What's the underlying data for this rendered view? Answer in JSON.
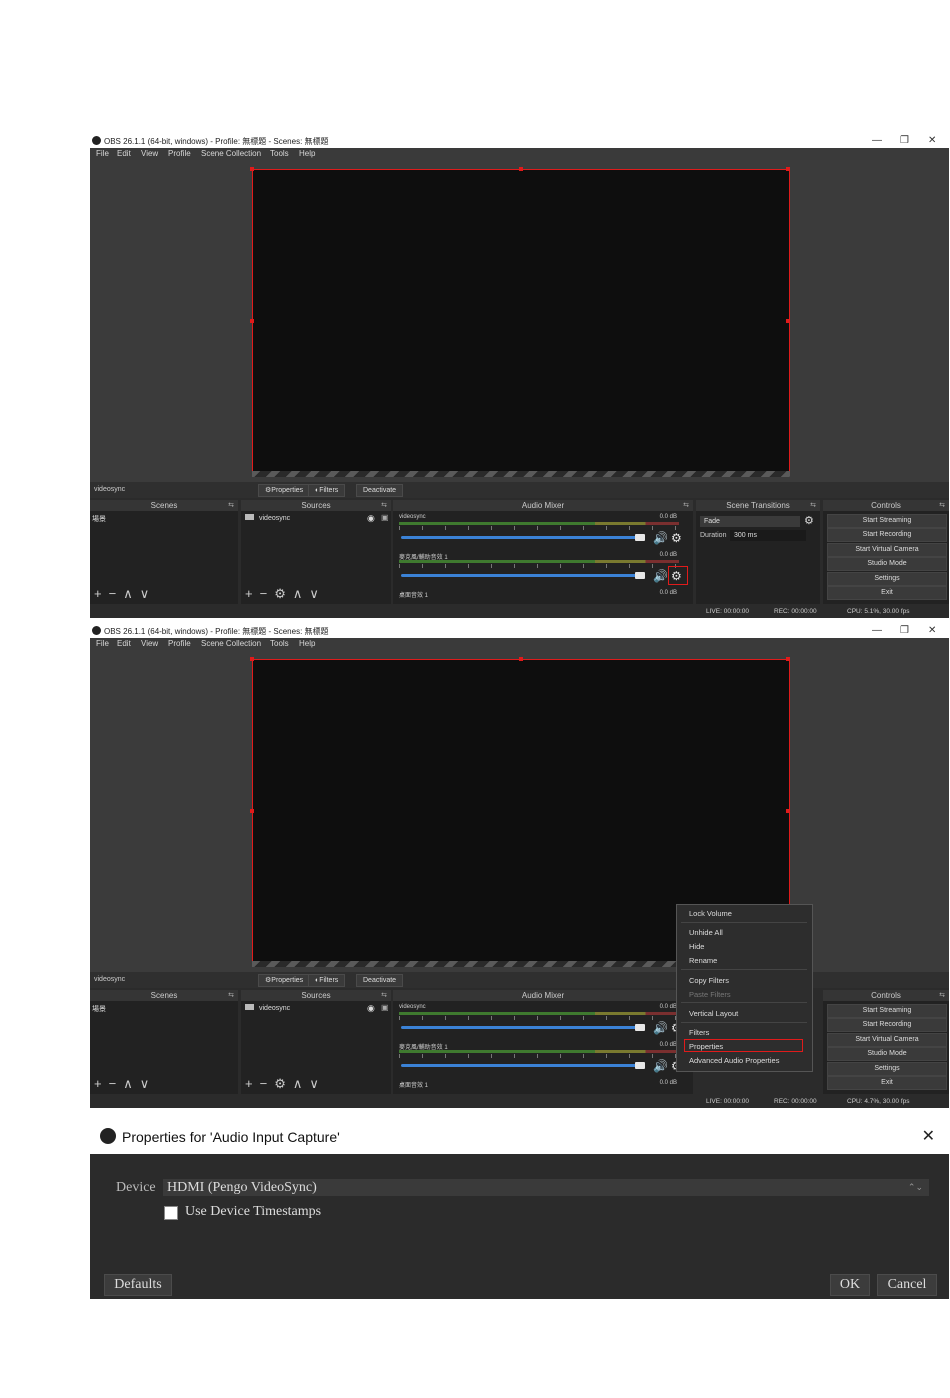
{
  "window": {
    "title": "OBS 26.1.1 (64-bit, windows) - Profile: 無標題 - Scenes: 無標題",
    "minimize": "—",
    "maximize": "❐",
    "close": "✕"
  },
  "menu": [
    "File",
    "Edit",
    "View",
    "Profile",
    "Scene Collection",
    "Tools",
    "Help"
  ],
  "source_toolbar": {
    "source_name": "videosync",
    "properties": "⚙Properties",
    "filters": "◐Filters",
    "deactivate": "Deactivate"
  },
  "docks": {
    "scenes": {
      "title": "Scenes",
      "items": [
        "場景"
      ],
      "tools": [
        "+",
        "−",
        "∧",
        "∨"
      ]
    },
    "sources": {
      "title": "Sources",
      "items": [
        "videosync"
      ],
      "tools": [
        "+",
        "−",
        "⚙",
        "∧",
        "∨"
      ]
    },
    "mixer": {
      "title": "Audio Mixer",
      "channels": [
        {
          "name": "videosync",
          "db": "0.0 dB"
        },
        {
          "name": "麥克風/輔助音效 1",
          "db": "0.0 dB"
        },
        {
          "name": "桌面音效 1",
          "db": "0.0 dB"
        }
      ]
    },
    "transitions": {
      "title": "Scene Transitions",
      "type": "Fade",
      "duration_label": "Duration",
      "duration": "300 ms"
    },
    "controls": {
      "title": "Controls",
      "buttons": [
        "Start Streaming",
        "Start Recording",
        "Start Virtual Camera",
        "Studio Mode",
        "Settings",
        "Exit"
      ]
    }
  },
  "status": {
    "live": "LIVE: 00:00:00",
    "rec": "REC: 00:00:00",
    "cpu_1": "CPU: 5.1%, 30.00 fps",
    "cpu_2": "CPU: 4.7%, 30.00 fps"
  },
  "context_menu": {
    "items": [
      "Lock Volume",
      "Unhide All",
      "Hide",
      "Rename",
      "Copy Filters",
      "Paste Filters",
      "Vertical Layout",
      "Filters",
      "Properties",
      "Advanced Audio Properties"
    ],
    "highlighted": "Properties"
  },
  "dialog": {
    "title": "Properties for 'Audio Input Capture'",
    "close": "✕",
    "device_label": "Device",
    "device_value": "HDMI (Pengo VideoSync)",
    "checkbox_label": "Use Device Timestamps",
    "checkbox_checked": false,
    "defaults": "Defaults",
    "ok": "OK",
    "cancel": "Cancel"
  },
  "colors": {
    "accent_red": "#e01b1b",
    "slider_blue": "#3b82d6",
    "dark_bg": "#2b2b2b"
  },
  "icons": [
    "obs-logo-icon",
    "gear-icon",
    "speaker-icon",
    "eye-icon",
    "lock-icon",
    "close-icon"
  ]
}
